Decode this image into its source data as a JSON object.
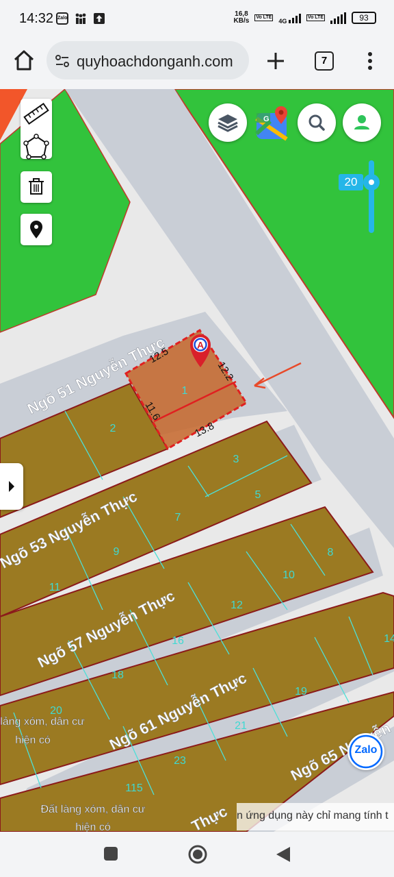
{
  "status_bar": {
    "time": "14:32",
    "notif_icons": [
      "zalo-icon",
      "people-icon",
      "upload-icon"
    ],
    "zalo_label": "Zalo",
    "net_speed_value": "16,8",
    "net_speed_unit": "KB/s",
    "volte1": "Vo LTE",
    "network_type": "4G",
    "volte2": "Vo LTE",
    "battery": "93"
  },
  "browser": {
    "url": "quyhoachdonganh.com",
    "tab_count": "7"
  },
  "map": {
    "zoom_level": "20",
    "roads": [
      "Ngõ 51 Nguyễn Thực",
      "Ngõ 53 Nguyễn Thực",
      "Ngõ 57 Nguyễn Thực",
      "Ngõ 61 Nguyễn Thực",
      "Ngõ 65 Nguyễn"
    ],
    "road_fragment": "Thực",
    "selected_parcel": {
      "number": "1",
      "dimensions": [
        "12.5",
        "12.2",
        "11.6",
        "13.8"
      ],
      "marker_letter": "A"
    },
    "parcels": [
      "2",
      "3",
      "5",
      "7",
      "9",
      "11",
      "8",
      "10",
      "12",
      "16",
      "18",
      "14",
      "19",
      "21",
      "20",
      "23",
      "115"
    ],
    "area_labels": {
      "village_1_line1": "lảng xóm, dân cư",
      "village_1_line2": "hiện có",
      "village_2_line1": "Đất làng xóm, dân cư",
      "village_2_line2": "hiện có"
    },
    "zalo_label": "Zalo",
    "notice": "n ứng dụng này chỉ mang tính t"
  },
  "colors": {
    "green_zone": "#32c33c",
    "parcel_fill": "#9b7a22",
    "selected_fill": "#c6662a",
    "road": "#c9ced6",
    "accent": "#25b6e8",
    "parcel_line": "#4de0d8"
  }
}
